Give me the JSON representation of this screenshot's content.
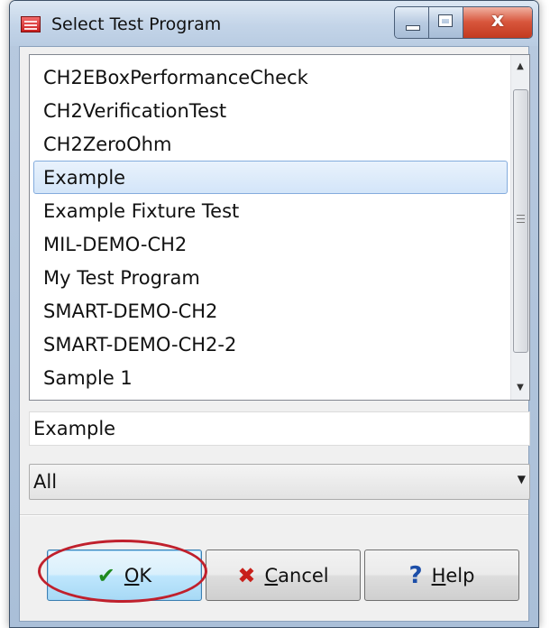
{
  "window": {
    "title": "Select Test Program",
    "caption_buttons": {
      "minimize": "minimize",
      "maximize": "maximize",
      "close": "x"
    }
  },
  "program_list": {
    "items": [
      {
        "label": "CH2EBoxPerformanceCheck",
        "selected": false
      },
      {
        "label": "CH2VerificationTest",
        "selected": false
      },
      {
        "label": "CH2ZeroOhm",
        "selected": false
      },
      {
        "label": "Example",
        "selected": true
      },
      {
        "label": "Example Fixture Test",
        "selected": false
      },
      {
        "label": "MIL-DEMO-CH2",
        "selected": false
      },
      {
        "label": "My Test Program",
        "selected": false
      },
      {
        "label": "SMART-DEMO-CH2",
        "selected": false
      },
      {
        "label": "SMART-DEMO-CH2-2",
        "selected": false
      },
      {
        "label": "Sample 1",
        "selected": false
      }
    ]
  },
  "name_field": {
    "value": "Example"
  },
  "filter": {
    "selected": "All"
  },
  "buttons": {
    "ok": {
      "accel": "O",
      "rest": "K",
      "icon": "check-icon"
    },
    "cancel": {
      "accel": "C",
      "rest": "ancel",
      "icon": "x-icon"
    },
    "help": {
      "accel": "H",
      "rest": "elp",
      "icon": "question-icon"
    }
  },
  "colors": {
    "selection": "#d3e5f9",
    "ok_check": "#1f8a1f",
    "cancel_x": "#c8201a",
    "help_q": "#1c4ea8",
    "annotation": "#c0202c"
  }
}
